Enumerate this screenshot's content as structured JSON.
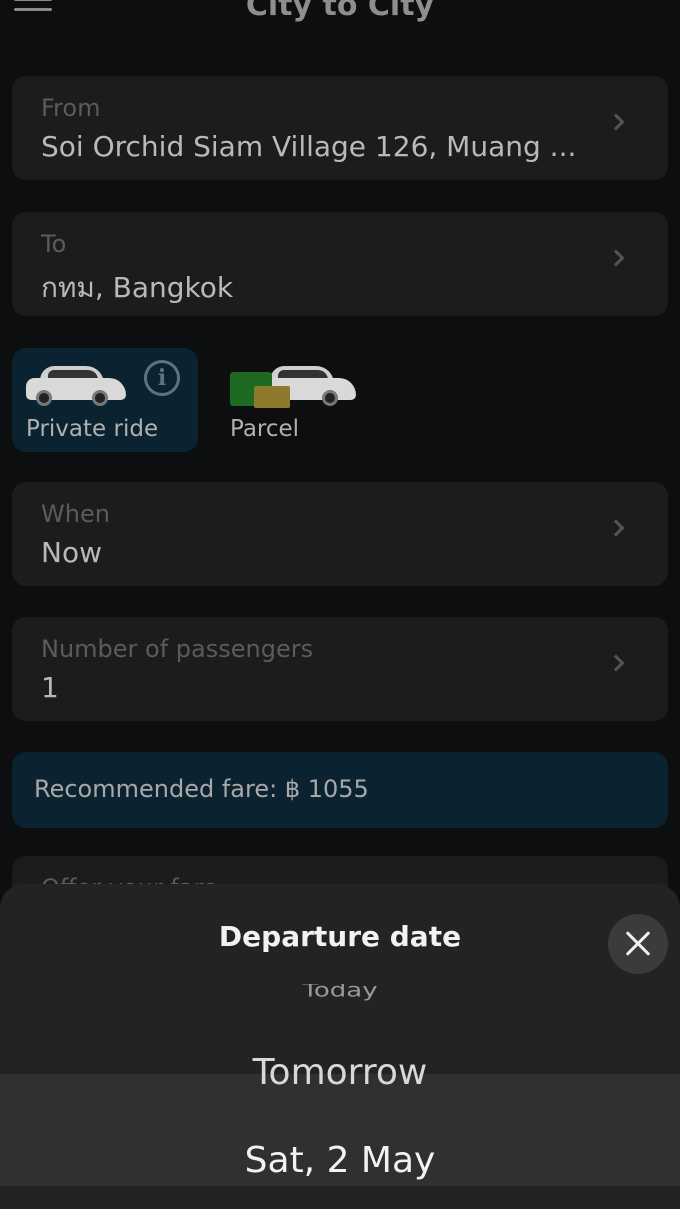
{
  "header": {
    "title": "City to City"
  },
  "form": {
    "from": {
      "label": "From",
      "value": "Soi Orchid Siam Village 126, Muang ..."
    },
    "to": {
      "label": "To",
      "value": "กทม, Bangkok"
    },
    "ride_types": [
      {
        "label": "Private ride",
        "selected": true
      },
      {
        "label": "Parcel",
        "selected": false
      }
    ],
    "when": {
      "label": "When",
      "value": "Now"
    },
    "passengers": {
      "label": "Number of passengers",
      "value": "1"
    },
    "fare": "Recommended fare: ฿ 1055",
    "offer_label": "Offer your fare"
  },
  "sheet": {
    "title": "Departure date",
    "options": [
      "Today",
      "Tomorrow",
      "Sat, 2 May"
    ]
  },
  "colors": {
    "background": "#0d0e0f",
    "card": "#1b1c1e",
    "accent_tile": "#0b2330",
    "sheet": "#232323"
  }
}
